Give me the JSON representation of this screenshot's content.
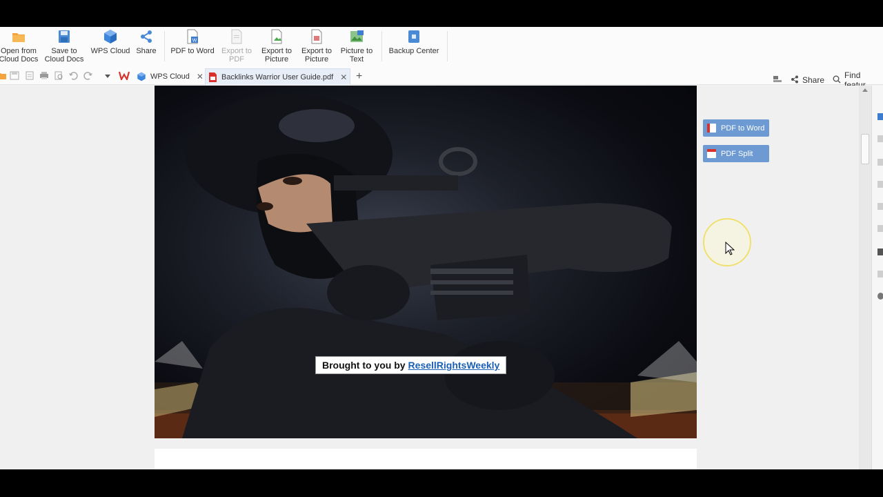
{
  "ribbon": {
    "open_cloud": "Open from\nCloud Docs",
    "save_cloud": "Save to\nCloud Docs",
    "wps_cloud": "WPS Cloud",
    "share": "Share",
    "pdf_to_word": "PDF to Word",
    "export_pdf": "Export to\nPDF",
    "export_picture_1": "Export to\nPicture",
    "export_picture_2": "Export to\nPicture",
    "picture_to_text": "Picture to\nText",
    "backup_center": "Backup Center"
  },
  "tabs": {
    "wps_cloud": "WPS Cloud",
    "document": "Backlinks Warrior User Guide.pdf",
    "share": "Share",
    "find": "Find featur"
  },
  "document": {
    "caption_prefix": "Brought to you by",
    "caption_link": "ResellRightsWeekly"
  },
  "floating": {
    "pdf_to_word": "PDF to Word",
    "pdf_split": "PDF Split"
  },
  "colors": {
    "accent": "#6d9ad3",
    "link": "#1a5fb4",
    "wps_red": "#d9302b"
  }
}
